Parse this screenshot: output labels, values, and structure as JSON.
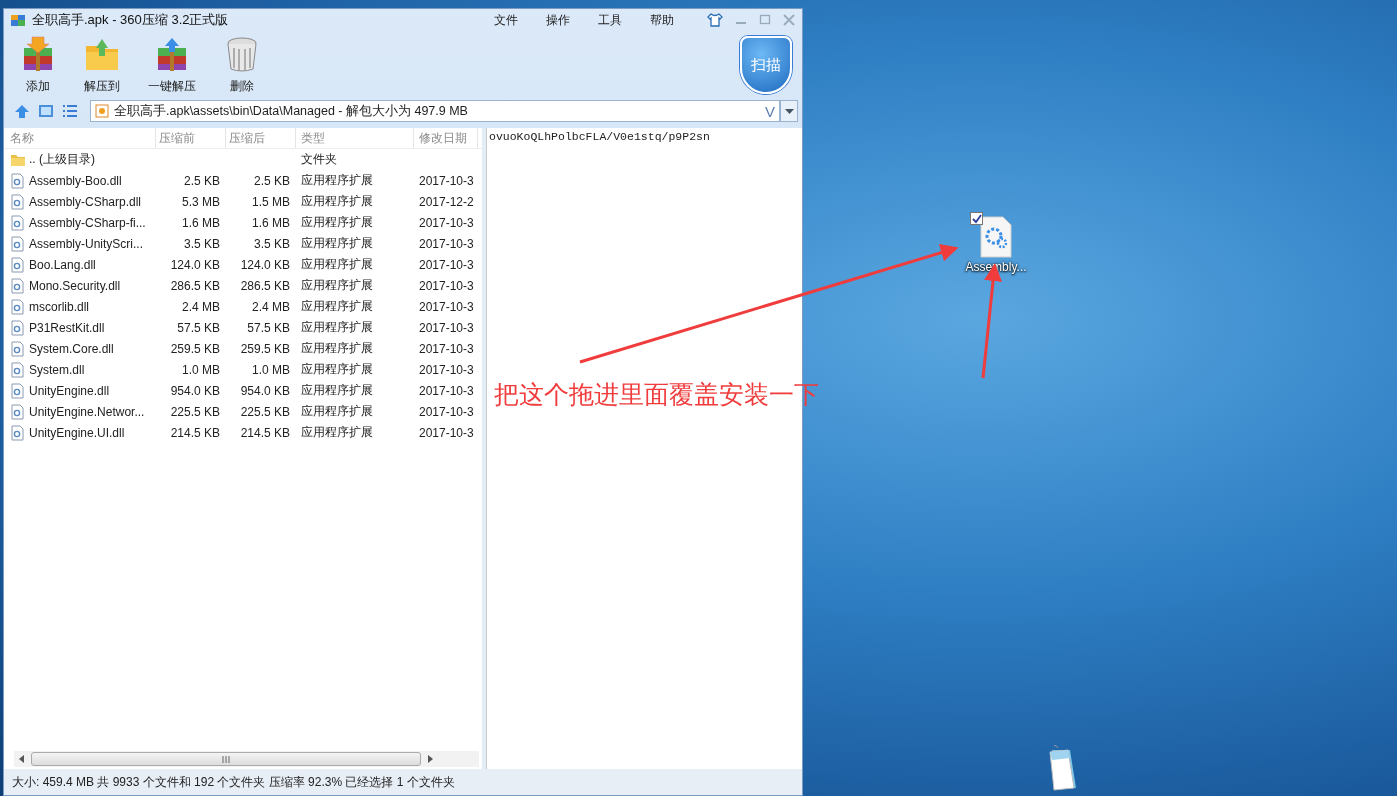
{
  "window": {
    "title": "全职高手.apk - 360压缩 3.2正式版"
  },
  "menu": [
    "文件",
    "操作",
    "工具",
    "帮助"
  ],
  "toolbar": [
    {
      "kind": "add",
      "label": "添加"
    },
    {
      "kind": "extract",
      "label": "解压到"
    },
    {
      "kind": "oneclick",
      "label": "一键解压"
    },
    {
      "kind": "delete",
      "label": "删除"
    }
  ],
  "scan_button": {
    "label": "扫描"
  },
  "address_bar": {
    "value": "全职高手.apk\\assets\\bin\\Data\\Managed - 解包大小为 497.9 MB",
    "history_button": "V"
  },
  "file_list": {
    "columns": [
      "名称",
      "压缩前",
      "压缩后",
      "类型",
      "修改日期"
    ],
    "rows": [
      {
        "kind": "folder",
        "name": ".. (上级目录)",
        "type": "文件夹"
      },
      {
        "kind": "file",
        "name": "Assembly-Boo.dll",
        "size": "2.5 KB",
        "packed": "2.5 KB",
        "type": "应用程序扩展",
        "date": "2017-10-3"
      },
      {
        "kind": "file",
        "name": "Assembly-CSharp.dll",
        "size": "5.3 MB",
        "packed": "1.5 MB",
        "type": "应用程序扩展",
        "date": "2017-12-2"
      },
      {
        "kind": "file",
        "name": "Assembly-CSharp-fi...",
        "size": "1.6 MB",
        "packed": "1.6 MB",
        "type": "应用程序扩展",
        "date": "2017-10-3"
      },
      {
        "kind": "file",
        "name": "Assembly-UnityScri...",
        "size": "3.5 KB",
        "packed": "3.5 KB",
        "type": "应用程序扩展",
        "date": "2017-10-3"
      },
      {
        "kind": "file",
        "name": "Boo.Lang.dll",
        "size": "124.0 KB",
        "packed": "124.0 KB",
        "type": "应用程序扩展",
        "date": "2017-10-3"
      },
      {
        "kind": "file",
        "name": "Mono.Security.dll",
        "size": "286.5 KB",
        "packed": "286.5 KB",
        "type": "应用程序扩展",
        "date": "2017-10-3"
      },
      {
        "kind": "file",
        "name": "mscorlib.dll",
        "size": "2.4 MB",
        "packed": "2.4 MB",
        "type": "应用程序扩展",
        "date": "2017-10-3"
      },
      {
        "kind": "file",
        "name": "P31RestKit.dll",
        "size": "57.5 KB",
        "packed": "57.5 KB",
        "type": "应用程序扩展",
        "date": "2017-10-3"
      },
      {
        "kind": "file",
        "name": "System.Core.dll",
        "size": "259.5 KB",
        "packed": "259.5 KB",
        "type": "应用程序扩展",
        "date": "2017-10-3"
      },
      {
        "kind": "file",
        "name": "System.dll",
        "size": "1.0 MB",
        "packed": "1.0 MB",
        "type": "应用程序扩展",
        "date": "2017-10-3"
      },
      {
        "kind": "file",
        "name": "UnityEngine.dll",
        "size": "954.0 KB",
        "packed": "954.0 KB",
        "type": "应用程序扩展",
        "date": "2017-10-3"
      },
      {
        "kind": "file",
        "name": "UnityEngine.Networ...",
        "size": "225.5 KB",
        "packed": "225.5 KB",
        "type": "应用程序扩展",
        "date": "2017-10-3"
      },
      {
        "kind": "file",
        "name": "UnityEngine.UI.dll",
        "size": "214.5 KB",
        "packed": "214.5 KB",
        "type": "应用程序扩展",
        "date": "2017-10-3"
      }
    ]
  },
  "preview": {
    "text": "ovuoKoQLhPolbcFLA/V0e1stq/p9P2sn"
  },
  "status_bar": "大小: 459.4 MB 共 9933 个文件和 192 个文件夹 压缩率 92.3% 已经选择 1 个文件夹",
  "desktop": {
    "icon": {
      "label": "Assembly...",
      "checked": true
    },
    "annotation": "把这个拖进里面覆盖安装一下"
  }
}
